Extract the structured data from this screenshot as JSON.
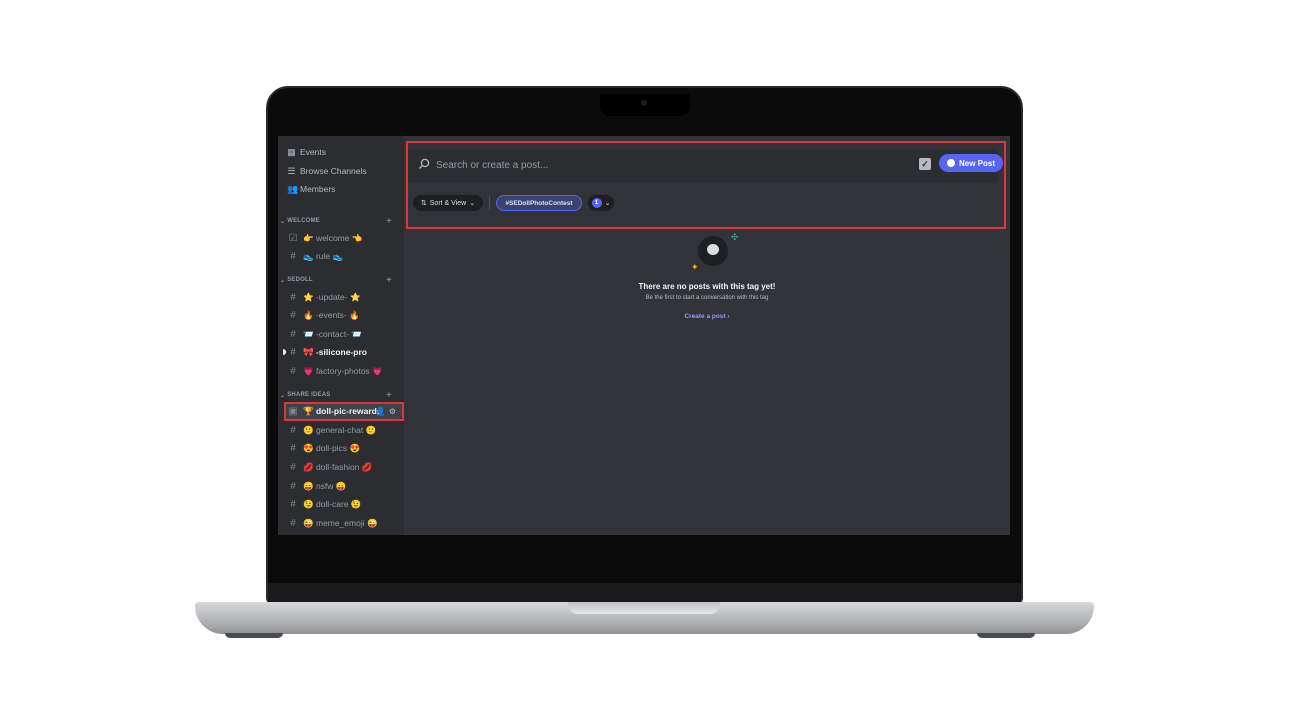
{
  "sidebar": {
    "nav": [
      {
        "label": "Events",
        "icon": "calendar-icon"
      },
      {
        "label": "Browse Channels",
        "icon": "browse-channels-icon"
      },
      {
        "label": "Members",
        "icon": "members-icon"
      }
    ],
    "categories": [
      {
        "name": "WELCOME"
      },
      {
        "name": "SEDOLL"
      },
      {
        "name": "SHARE IDEAS"
      }
    ],
    "channels": [
      {
        "label": "👉 welcome 👈",
        "icon": "rules-icon"
      },
      {
        "label": "👟 rule 👟",
        "icon": "hash-icon"
      },
      {
        "label": "⭐ -update- ⭐",
        "icon": "hash-icon"
      },
      {
        "label": "🔥 -events- 🔥",
        "icon": "hash-icon"
      },
      {
        "label": "📨 -contact- 📨",
        "icon": "hash-icon"
      },
      {
        "label": "🎀 -silicone-pro",
        "icon": "hash-icon"
      },
      {
        "label": "💗 factory-photos 💗",
        "icon": "hash-icon"
      },
      {
        "label": "🏆 doll-pic-rewards",
        "icon": "forum-icon"
      },
      {
        "label": "🙂 general-chat 🙂",
        "icon": "hash-icon"
      },
      {
        "label": "😍 doll-pics 😍",
        "icon": "hash-icon"
      },
      {
        "label": "💋 doll-fashion 💋",
        "icon": "hash-icon"
      },
      {
        "label": "😛 nsfw 😛",
        "icon": "hash-icon"
      },
      {
        "label": "😉 doll-care 😉",
        "icon": "hash-icon"
      },
      {
        "label": "😜 meme_emoji 😜",
        "icon": "hash-icon"
      }
    ]
  },
  "main": {
    "search_placeholder": "Search or create a post...",
    "new_post_label": "New Post",
    "sort_label": "Sort & View",
    "tag_label": "#SEDollPhotoContest",
    "tag_count": "1",
    "empty_title": "There are no posts with this tag yet!",
    "empty_subtitle": "Be the first to start a conversation with this tag",
    "create_post_label": "Create a post"
  },
  "colors": {
    "accent": "#5865f2",
    "highlight_box": "#d9363e",
    "sidebar_bg": "#2b2d31",
    "main_bg": "#313338"
  }
}
